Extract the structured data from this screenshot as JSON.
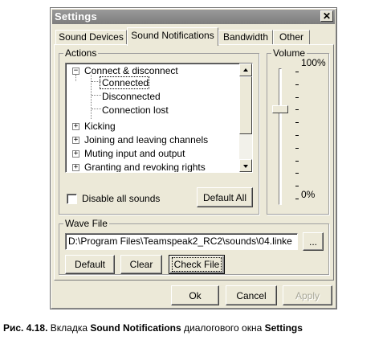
{
  "window": {
    "title": "Settings",
    "close_glyph": "✕"
  },
  "tabs": [
    {
      "label": "Sound Devices",
      "active": false
    },
    {
      "label": "Sound Notifications",
      "active": true
    },
    {
      "label": "Bandwidth",
      "active": false
    },
    {
      "label": "Other",
      "active": false
    }
  ],
  "actions": {
    "group_label": "Actions",
    "tree": [
      {
        "label": "Connect & disconnect",
        "expanded": true,
        "level": 0
      },
      {
        "label": "Connected",
        "level": 1,
        "selected": true
      },
      {
        "label": "Disconnected",
        "level": 1
      },
      {
        "label": "Connection lost",
        "level": 1
      },
      {
        "label": "Kicking",
        "expanded": false,
        "level": 0
      },
      {
        "label": "Joining and leaving  channels",
        "expanded": false,
        "level": 0
      },
      {
        "label": "Muting input and output",
        "expanded": false,
        "level": 0
      },
      {
        "label": "Granting and revoking rights",
        "expanded": false,
        "level": 0
      }
    ],
    "expander_collapsed": "+",
    "expander_expanded": "−",
    "disable_all_label": "Disable all sounds",
    "disable_all_checked": false,
    "default_all_label": "Default All"
  },
  "volume": {
    "group_label": "Volume",
    "max_label": "100%",
    "min_label": "0%",
    "level_percent": 70
  },
  "wave_file": {
    "group_label": "Wave File",
    "path_value": "D:\\Program Files\\Teamspeak2_RC2\\sounds\\04.linke",
    "browse_label": "...",
    "default_label": "Default",
    "clear_label": "Clear",
    "check_file_label": "Check File"
  },
  "footer": {
    "ok_label": "Ok",
    "cancel_label": "Cancel",
    "apply_label": "Apply",
    "apply_enabled": false
  },
  "caption": {
    "prefix": "Рис. 4.18.",
    "text1": " Вкладка ",
    "bold1": "Sound Notifications",
    "text2": " диалогового окна ",
    "bold2": "Settings"
  }
}
